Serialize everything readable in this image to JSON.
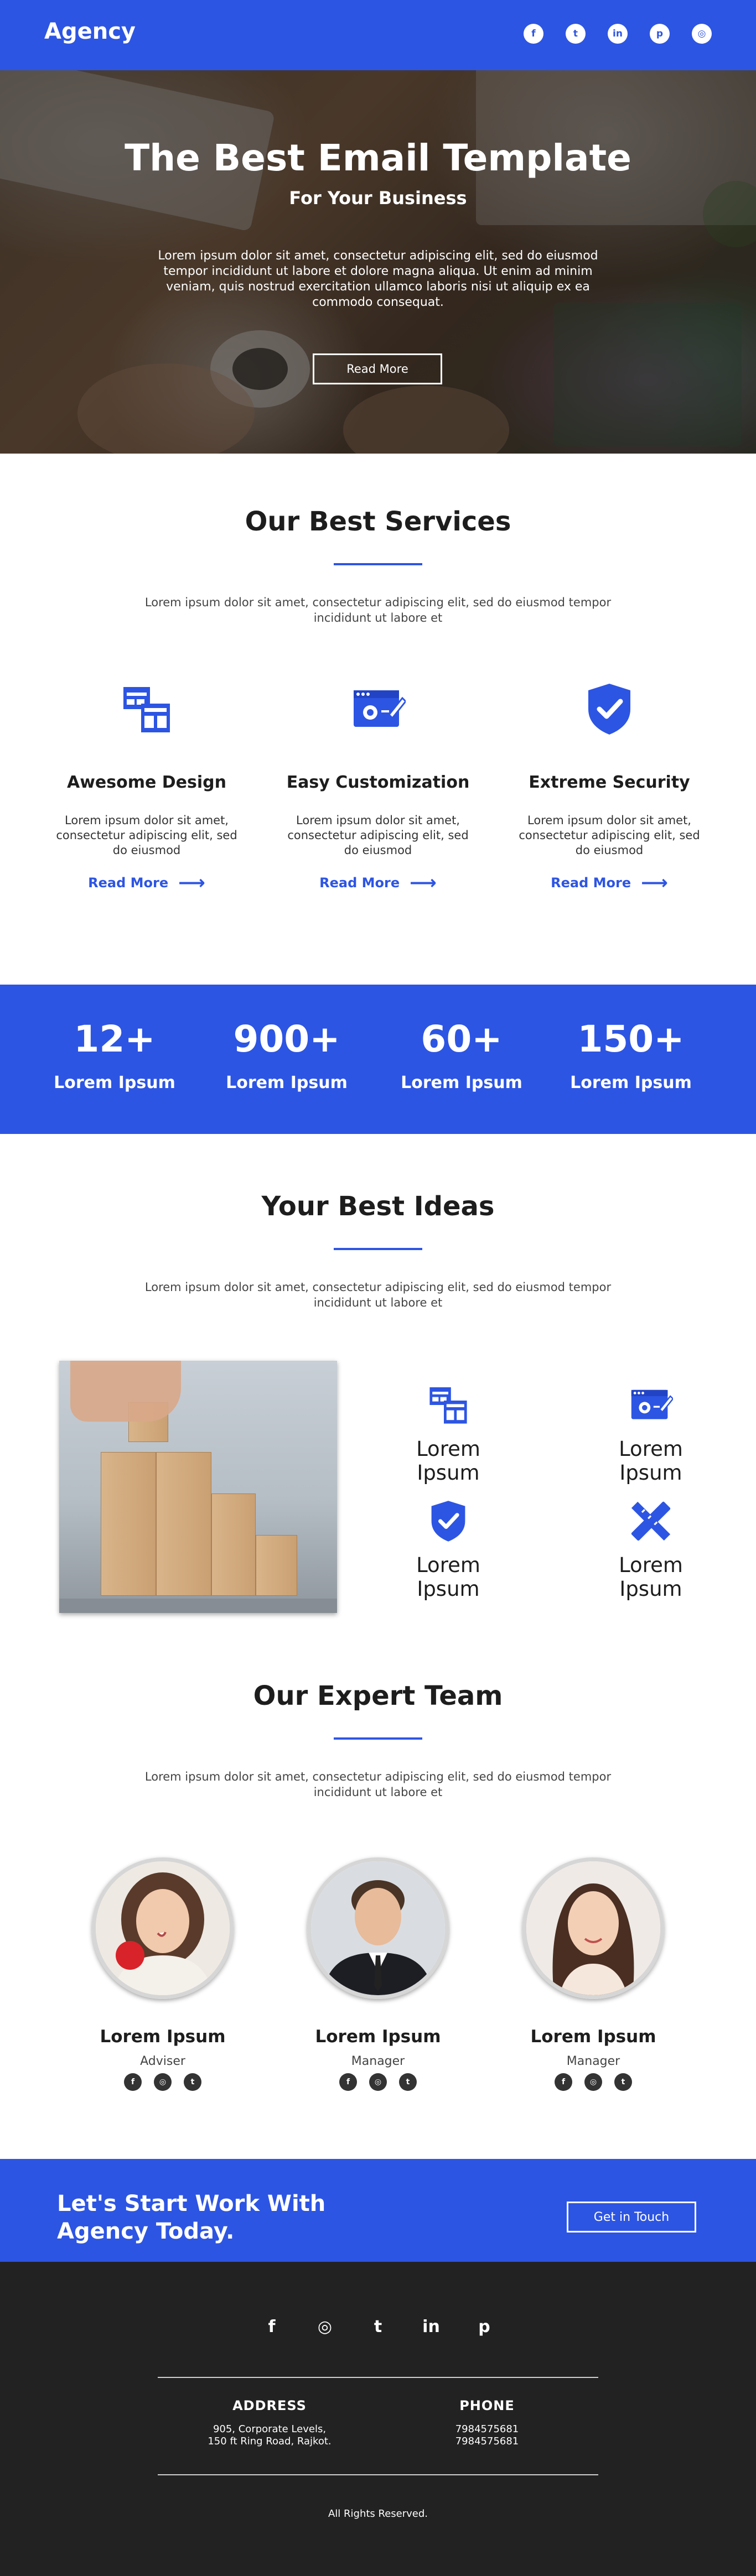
{
  "header": {
    "brand": "Agency",
    "social": [
      {
        "icon": "facebook-icon",
        "glyph": "f"
      },
      {
        "icon": "twitter-icon",
        "glyph": "t"
      },
      {
        "icon": "linkedin-icon",
        "glyph": "in"
      },
      {
        "icon": "pinterest-icon",
        "glyph": "p"
      },
      {
        "icon": "instagram-icon",
        "glyph": "◎"
      }
    ]
  },
  "hero": {
    "title": "The Best Email Template",
    "subtitle": "For Your Business",
    "text": "Lorem ipsum dolor sit amet, consectetur adipiscing elit, sed do eiusmod tempor incididunt ut labore et dolore magna aliqua. Ut enim ad minim veniam, quis nostrud exercitation ullamco laboris nisi ut aliquip ex ea commodo consequat.",
    "button": "Read More"
  },
  "services": {
    "title": "Our Best Services",
    "subtitle": "Lorem ipsum dolor sit amet, consectetur adipiscing elit, sed do eiusmod tempor incididunt ut labore et",
    "items": [
      {
        "icon": "layout-icon",
        "title": "Awesome Design",
        "text": "Lorem ipsum dolor sit amet, consectetur adipiscing elit, sed do eiusmod",
        "link": "Read More"
      },
      {
        "icon": "browser-settings-icon",
        "title": "Easy Customization",
        "text": "Lorem ipsum dolor sit amet, consectetur adipiscing elit, sed do eiusmod",
        "link": "Read More"
      },
      {
        "icon": "shield-check-icon",
        "title": "Extreme Security",
        "text": "Lorem ipsum dolor sit amet, consectetur adipiscing elit, sed do eiusmod",
        "link": "Read More"
      }
    ]
  },
  "stats": [
    {
      "number": "12+",
      "label": "Lorem Ipsum"
    },
    {
      "number": "900+",
      "label": "Lorem Ipsum"
    },
    {
      "number": "60+",
      "label": "Lorem Ipsum"
    },
    {
      "number": "150+",
      "label": "Lorem Ipsum"
    }
  ],
  "ideas": {
    "title": "Your Best Ideas",
    "subtitle": "Lorem ipsum dolor sit amet, consectetur adipiscing elit, sed do eiusmod tempor incididunt ut labore et",
    "items": [
      {
        "icon": "layout-icon",
        "label": "Lorem Ipsum"
      },
      {
        "icon": "browser-settings-icon",
        "label": "Lorem Ipsum"
      },
      {
        "icon": "shield-check-icon",
        "label": "Lorem Ipsum"
      },
      {
        "icon": "design-tools-icon",
        "label": "Lorem Ipsum"
      }
    ]
  },
  "team": {
    "title": "Our Expert Team",
    "subtitle": "Lorem ipsum dolor sit amet, consectetur adipiscing elit, sed do eiusmod tempor incididunt ut labore et",
    "members": [
      {
        "name": "Lorem Ipsum",
        "role": "Adviser"
      },
      {
        "name": "Lorem Ipsum",
        "role": "Manager"
      },
      {
        "name": "Lorem Ipsum",
        "role": "Manager"
      }
    ]
  },
  "cta": {
    "title": "Let's Start Work With Agency Today.",
    "button": "Get in Touch"
  },
  "footer": {
    "social": [
      {
        "icon": "facebook-icon",
        "glyph": "f"
      },
      {
        "icon": "instagram-icon",
        "glyph": "◎"
      },
      {
        "icon": "twitter-icon",
        "glyph": "t"
      },
      {
        "icon": "linkedin-icon",
        "glyph": "in"
      },
      {
        "icon": "pinterest-icon",
        "glyph": "p"
      }
    ],
    "address_heading": "ADDRESS",
    "address_line1": "905, Corporate Levels,",
    "address_line2": "150 ft Ring Road, Rajkot.",
    "phone_heading": "PHONE",
    "phone1": "7984575681",
    "phone2": "7984575681",
    "rights": "All Rights Reserved."
  },
  "colors": {
    "accent": "#2d55e3",
    "footer": "#222222"
  }
}
